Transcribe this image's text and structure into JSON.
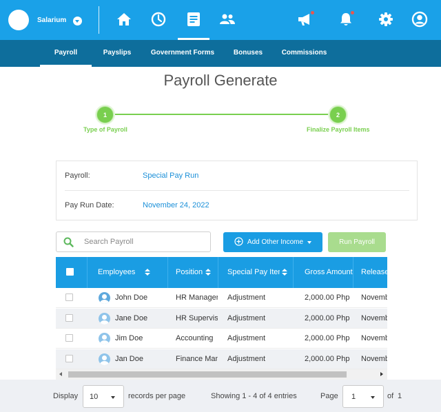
{
  "topbar": {
    "company_name": "Salarium",
    "nav_icons": [
      "home-icon",
      "clock-icon",
      "document-icon",
      "people-icon"
    ],
    "right_icons": [
      "megaphone-icon",
      "bell-icon",
      "gear-icon",
      "user-icon"
    ]
  },
  "subnav": {
    "items": [
      {
        "label": "Payroll",
        "active": true
      },
      {
        "label": "Payslips",
        "active": false
      },
      {
        "label": "Government Forms",
        "active": false
      },
      {
        "label": "Bonuses",
        "active": false
      },
      {
        "label": "Commissions",
        "active": false
      }
    ]
  },
  "page_title": "Payroll Generate",
  "stepper": {
    "steps": [
      {
        "number": "1",
        "label": "Type of Payroll"
      },
      {
        "number": "2",
        "label": "Finalize Payroll Items"
      }
    ]
  },
  "info": {
    "payroll_label": "Payroll:",
    "payroll_value": "Special Pay Run",
    "date_label": "Pay Run Date:",
    "date_value": "November 24, 2022"
  },
  "toolbar": {
    "search_placeholder": "Search Payroll",
    "add_income_label": "Add Other Income",
    "run_payroll_label": "Run Payroll"
  },
  "table": {
    "columns": [
      "Employees",
      "Position",
      "Special Pay Items",
      "Gross Amount",
      "Release"
    ],
    "rows": [
      {
        "name": "John Doe",
        "position": "HR Manager",
        "item": "Adjustment",
        "gross": "2,000.00 Php",
        "release": "November"
      },
      {
        "name": "Jane Doe",
        "position": "HR Supervisor",
        "item": "Adjustment",
        "gross": "2,000.00 Php",
        "release": "November"
      },
      {
        "name": "Jim Doe",
        "position": "Accounting",
        "item": "Adjustment",
        "gross": "2,000.00 Php",
        "release": "November"
      },
      {
        "name": "Jan Doe",
        "position": "Finance Manager",
        "item": "Adjustment",
        "gross": "2,000.00 Php",
        "release": "November"
      }
    ]
  },
  "footer": {
    "display_label": "Display",
    "records_value": "10",
    "records_label": "records per page",
    "showing_text": "Showing 1 - 4 of 4 entries",
    "page_label": "Page",
    "page_value": "1",
    "of_label": "of",
    "total_pages": "1"
  },
  "colors": {
    "primary": "#1aa1e8",
    "subnav": "#0e6e9c",
    "success": "#79cf4f",
    "notification": "#e8574f"
  }
}
